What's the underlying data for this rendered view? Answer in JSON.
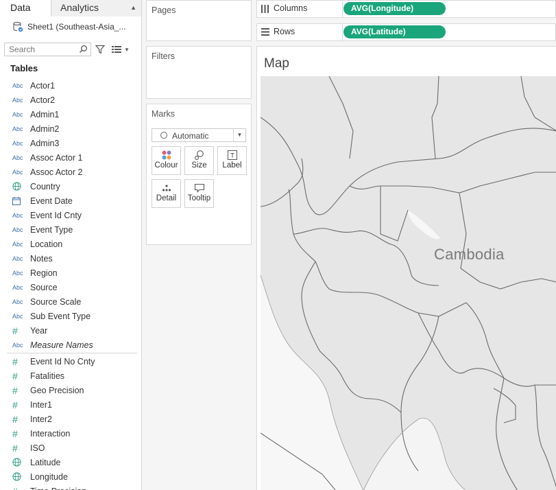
{
  "data_pane": {
    "tabs": [
      "Data",
      "Analytics"
    ],
    "datasource": "Sheet1 (Southeast-Asia_...",
    "search_placeholder": "Search",
    "tables_title": "Tables",
    "dimensions": [
      {
        "type": "Abc",
        "name": "Actor1"
      },
      {
        "type": "Abc",
        "name": "Actor2"
      },
      {
        "type": "Abc",
        "name": "Admin1"
      },
      {
        "type": "Abc",
        "name": "Admin2"
      },
      {
        "type": "Abc",
        "name": "Admin3"
      },
      {
        "type": "Abc",
        "name": "Assoc Actor 1"
      },
      {
        "type": "Abc",
        "name": "Assoc Actor 2"
      },
      {
        "type": "geo",
        "name": "Country"
      },
      {
        "type": "date",
        "name": "Event Date"
      },
      {
        "type": "Abc",
        "name": "Event Id Cnty"
      },
      {
        "type": "Abc",
        "name": "Event Type"
      },
      {
        "type": "Abc",
        "name": "Location"
      },
      {
        "type": "Abc",
        "name": "Notes"
      },
      {
        "type": "Abc",
        "name": "Region"
      },
      {
        "type": "Abc",
        "name": "Source"
      },
      {
        "type": "Abc",
        "name": "Source Scale"
      },
      {
        "type": "Abc",
        "name": "Sub Event Type"
      },
      {
        "type": "#",
        "name": "Year"
      },
      {
        "type": "Abc",
        "name": "Measure Names",
        "italic": true
      }
    ],
    "measures": [
      {
        "type": "#",
        "name": "Event Id No Cnty"
      },
      {
        "type": "#",
        "name": "Fatalities"
      },
      {
        "type": "#",
        "name": "Geo Precision"
      },
      {
        "type": "#",
        "name": "Inter1"
      },
      {
        "type": "#",
        "name": "Inter2"
      },
      {
        "type": "#",
        "name": "Interaction"
      },
      {
        "type": "#",
        "name": "ISO"
      },
      {
        "type": "geo",
        "name": "Latitude"
      },
      {
        "type": "geo",
        "name": "Longitude"
      },
      {
        "type": "#",
        "name": "Time Precision"
      }
    ]
  },
  "cards": {
    "pages": "Pages",
    "filters": "Filters",
    "marks": "Marks",
    "mark_type": "Automatic",
    "mark_buttons": [
      "Colour",
      "Size",
      "Label",
      "Detail",
      "Tooltip"
    ]
  },
  "shelves": {
    "columns_label": "Columns",
    "columns_pill": "AVG(Longitude)",
    "rows_label": "Rows",
    "rows_pill": "AVG(Latitude)"
  },
  "view": {
    "title": "Map",
    "map_label": "Cambodia"
  },
  "colors": {
    "pill": "#1aa57b",
    "dimension_type": "#3a6ea5",
    "measure_type": "#2e9a86",
    "land": "#e6e6e6",
    "water": "#f7f7f7",
    "border": "#666666"
  },
  "icons": {
    "datasource": "database-icon",
    "search": "search-icon",
    "filter": "filter-icon",
    "view": "list-view-icon",
    "columns": "columns-icon",
    "rows": "rows-icon",
    "colour": "colour-icon",
    "size": "size-icon",
    "label": "label-icon",
    "detail": "detail-icon",
    "tooltip": "tooltip-icon"
  }
}
